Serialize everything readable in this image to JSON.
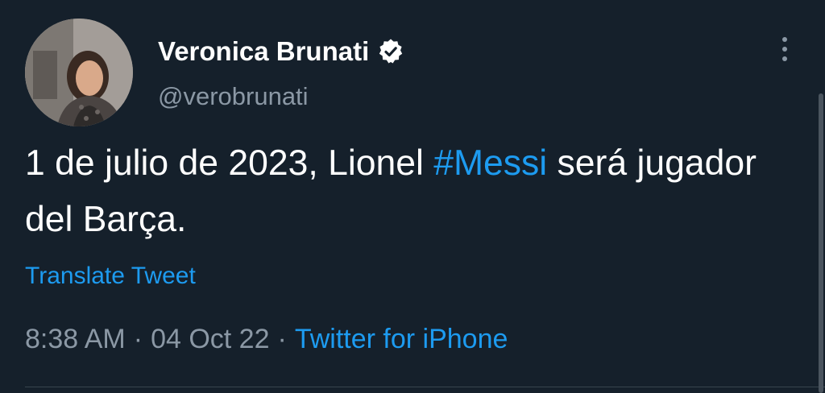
{
  "author": {
    "display_name": "Veronica Brunati",
    "handle": "@verobrunati",
    "verified": true,
    "avatar_icon": "user-avatar-photo"
  },
  "tweet": {
    "text_before": "1 de julio de 2023, Lionel ",
    "hashtag": "#Messi",
    "text_after": " será jugador del Barça.",
    "translate_label": "Translate Tweet"
  },
  "meta": {
    "time": "8:38 AM",
    "separator": "·",
    "date": "04 Oct 22",
    "source": "Twitter for iPhone"
  },
  "icons": {
    "verified": "verified-badge-icon",
    "more": "more-options-icon"
  },
  "colors": {
    "background": "#15202b",
    "text": "#ffffff",
    "secondary": "#8b98a5",
    "accent": "#1d9bf0"
  }
}
